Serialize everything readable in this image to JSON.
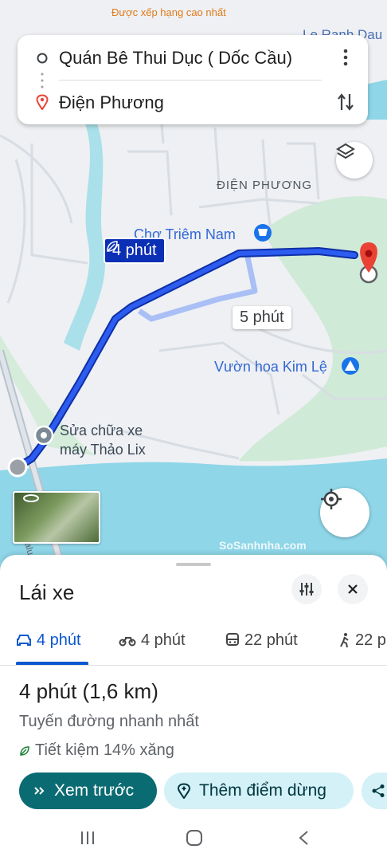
{
  "status_bar": {
    "notification_text": "Được xếp hạng cao nhất"
  },
  "route_card": {
    "origin": "Quán Bê Thui Dục ( Dốc Cầu)",
    "destination": "Điện Phương",
    "menu_icon": "more-vert-icon",
    "swap_icon": "swap-icon"
  },
  "map": {
    "top_label": "Le Ranh Dau",
    "area_label": "ĐIỆN PHƯƠNG",
    "market_label": "Chợ Triêm Nam",
    "park_label": "Vườn hoa Kim Lệ",
    "poi_label": "Sửa chữa xe\nmáy Thảo Lix",
    "road_label": "Lalu",
    "watermark": "SoSanhnha.com",
    "primary_route_time": "4 phút",
    "alt_route_time": "5 phút",
    "route_color": "#1a3fcc",
    "alt_route_color": "#a9bff5"
  },
  "sheet": {
    "title": "Lái xe",
    "modes": [
      {
        "icon": "car-icon",
        "label": "4 phút",
        "active": true
      },
      {
        "icon": "motorbike-icon",
        "label": "4 phút",
        "active": false
      },
      {
        "icon": "transit-icon",
        "label": "22 phút",
        "active": false
      },
      {
        "icon": "walk-icon",
        "label": "22 p",
        "active": false
      }
    ],
    "duration": "4 phút",
    "distance": "(1,6 km)",
    "route_desc": "Tuyến đường nhanh nhất",
    "eco_text": "Tiết kiệm 14% xăng",
    "preview_label": "Xem trước",
    "add_stop_label": "Thêm điểm dừng",
    "accent_color": "#0b57d0",
    "primary_button_color": "#0b6b73"
  }
}
